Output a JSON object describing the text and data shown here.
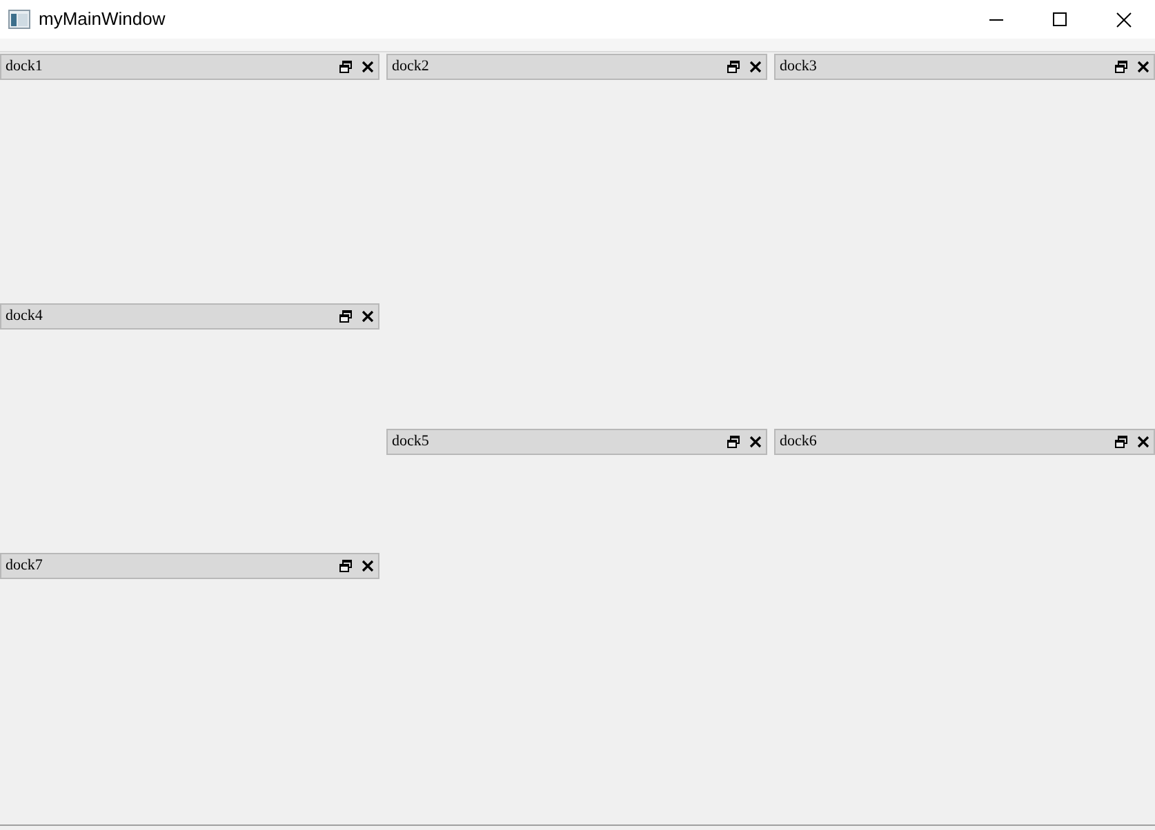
{
  "window": {
    "title": "myMainWindow"
  },
  "columns": [
    {
      "docks": [
        {
          "title": "dock1"
        },
        {
          "title": "dock4"
        },
        {
          "title": "dock7"
        }
      ]
    },
    {
      "docks": [
        {
          "title": "dock2"
        },
        {
          "title": "dock5"
        }
      ]
    },
    {
      "docks": [
        {
          "title": "dock3"
        },
        {
          "title": "dock6"
        }
      ]
    }
  ]
}
